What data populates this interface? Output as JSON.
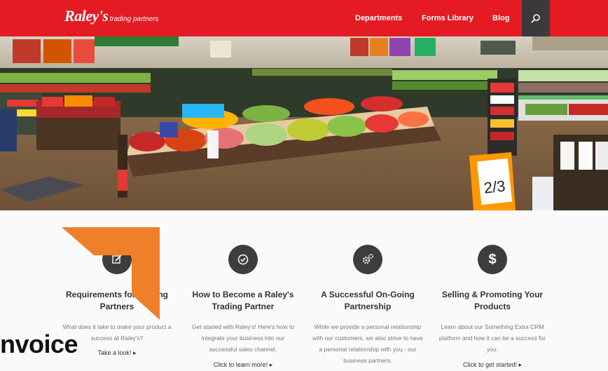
{
  "header": {
    "logo_main": "Raley's",
    "logo_sub": "trading partners",
    "nav": [
      "Departments",
      "Forms Library",
      "Blog"
    ],
    "search_icon": "search-icon",
    "colors": {
      "bar": "#e41b23",
      "search_bg": "#3a3a3a"
    }
  },
  "features": [
    {
      "icon": "edit-icon",
      "title": "Requirements for Trading Partners",
      "description": "What does it take to make your product a success at Raley's?",
      "link": "Take a look! ▸"
    },
    {
      "icon": "check-circle-icon",
      "title": "How to Become a Raley's Trading Partner",
      "description": "Get started with Raley's! Here's how to integrate your business into our successful sales channel.",
      "link": "Click to learn more! ▸"
    },
    {
      "icon": "gears-icon",
      "title": "A Successful On-Going Partnership",
      "description": "While we provide a personal relationship with our customers, we also strive to have a personal relationship with you - our business partners.",
      "link": ""
    },
    {
      "icon": "dollar-icon",
      "title": "Selling & Promoting Your Products",
      "description": "Learn about our Something Extra CRM platform and how it can be a success for you.",
      "link": "Click to get started! ▸"
    }
  ],
  "overlay": {
    "text": "nvoice",
    "arrow_color": "#f07f2a"
  },
  "hero": {
    "price_sign": "2/3"
  }
}
